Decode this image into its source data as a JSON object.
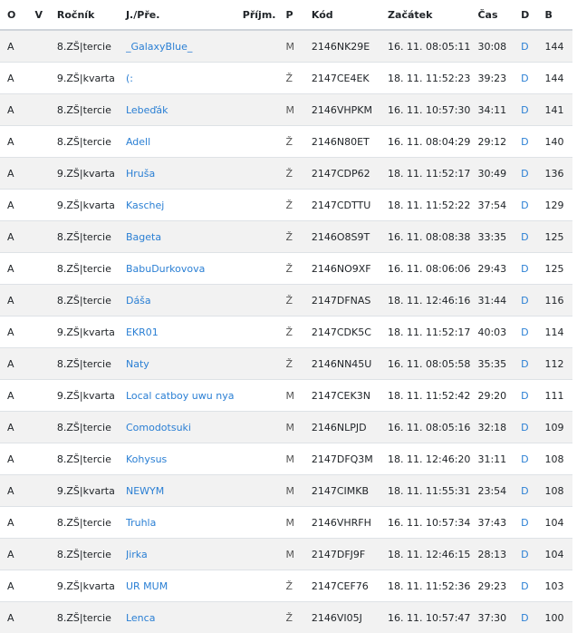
{
  "headers": {
    "o": "O",
    "v": "V",
    "rocnik": "Ročník",
    "name": "J./Pře.",
    "prijm": "Příjm.",
    "p": "P",
    "kod": "Kód",
    "zacatek": "Začátek",
    "cas": "Čas",
    "d": "D",
    "b": "B"
  },
  "rows": [
    {
      "o": "A",
      "v": "",
      "rocnik": "8.ZŠ|tercie",
      "name": "_GalaxyBlue_",
      "prijm": "",
      "p": "M",
      "kod": "2146NK29E",
      "zacatek": "16. 11. 08:05:11",
      "cas": "30:08",
      "d": "D",
      "b": "144"
    },
    {
      "o": "A",
      "v": "",
      "rocnik": "9.ZŠ|kvarta",
      "name": "(:",
      "prijm": "",
      "p": "Ž",
      "kod": "2147CE4EK",
      "zacatek": "18. 11. 11:52:23",
      "cas": "39:23",
      "d": "D",
      "b": "144"
    },
    {
      "o": "A",
      "v": "",
      "rocnik": "8.ZŠ|tercie",
      "name": "Lebeďák",
      "prijm": "",
      "p": "M",
      "kod": "2146VHPKM",
      "zacatek": "16. 11. 10:57:30",
      "cas": "34:11",
      "d": "D",
      "b": "141"
    },
    {
      "o": "A",
      "v": "",
      "rocnik": "8.ZŠ|tercie",
      "name": "Adell",
      "prijm": "",
      "p": "Ž",
      "kod": "2146N80ET",
      "zacatek": "16. 11. 08:04:29",
      "cas": "29:12",
      "d": "D",
      "b": "140"
    },
    {
      "o": "A",
      "v": "",
      "rocnik": "9.ZŠ|kvarta",
      "name": "Hruša",
      "prijm": "",
      "p": "Ž",
      "kod": "2147CDP62",
      "zacatek": "18. 11. 11:52:17",
      "cas": "30:49",
      "d": "D",
      "b": "136"
    },
    {
      "o": "A",
      "v": "",
      "rocnik": "9.ZŠ|kvarta",
      "name": "Kaschej",
      "prijm": "",
      "p": "Ž",
      "kod": "2147CDTTU",
      "zacatek": "18. 11. 11:52:22",
      "cas": "37:54",
      "d": "D",
      "b": "129"
    },
    {
      "o": "A",
      "v": "",
      "rocnik": "8.ZŠ|tercie",
      "name": "Bageta",
      "prijm": "",
      "p": "Ž",
      "kod": "2146O8S9T",
      "zacatek": "16. 11. 08:08:38",
      "cas": "33:35",
      "d": "D",
      "b": "125"
    },
    {
      "o": "A",
      "v": "",
      "rocnik": "8.ZŠ|tercie",
      "name": "BabuDurkovova",
      "prijm": "",
      "p": "Ž",
      "kod": "2146NO9XF",
      "zacatek": "16. 11. 08:06:06",
      "cas": "29:43",
      "d": "D",
      "b": "125"
    },
    {
      "o": "A",
      "v": "",
      "rocnik": "8.ZŠ|tercie",
      "name": "Dáša",
      "prijm": "",
      "p": "Ž",
      "kod": "2147DFNAS",
      "zacatek": "18. 11. 12:46:16",
      "cas": "31:44",
      "d": "D",
      "b": "116"
    },
    {
      "o": "A",
      "v": "",
      "rocnik": "9.ZŠ|kvarta",
      "name": "EKR01",
      "prijm": "",
      "p": "Ž",
      "kod": "2147CDK5C",
      "zacatek": "18. 11. 11:52:17",
      "cas": "40:03",
      "d": "D",
      "b": "114"
    },
    {
      "o": "A",
      "v": "",
      "rocnik": "8.ZŠ|tercie",
      "name": "Naty",
      "prijm": "",
      "p": "Ž",
      "kod": "2146NN45U",
      "zacatek": "16. 11. 08:05:58",
      "cas": "35:35",
      "d": "D",
      "b": "112"
    },
    {
      "o": "A",
      "v": "",
      "rocnik": "9.ZŠ|kvarta",
      "name": "Local catboy uwu nya",
      "prijm": "",
      "p": "M",
      "kod": "2147CEK3N",
      "zacatek": "18. 11. 11:52:42",
      "cas": "29:20",
      "d": "D",
      "b": "111"
    },
    {
      "o": "A",
      "v": "",
      "rocnik": "8.ZŠ|tercie",
      "name": "Comodotsuki",
      "prijm": "",
      "p": "M",
      "kod": "2146NLPJD",
      "zacatek": "16. 11. 08:05:16",
      "cas": "32:18",
      "d": "D",
      "b": "109"
    },
    {
      "o": "A",
      "v": "",
      "rocnik": "8.ZŠ|tercie",
      "name": "Kohysus",
      "prijm": "",
      "p": "M",
      "kod": "2147DFQ3M",
      "zacatek": "18. 11. 12:46:20",
      "cas": "31:11",
      "d": "D",
      "b": "108"
    },
    {
      "o": "A",
      "v": "",
      "rocnik": "9.ZŠ|kvarta",
      "name": "NEWYM",
      "prijm": "",
      "p": "M",
      "kod": "2147CIMKB",
      "zacatek": "18. 11. 11:55:31",
      "cas": "23:54",
      "d": "D",
      "b": "108"
    },
    {
      "o": "A",
      "v": "",
      "rocnik": "8.ZŠ|tercie",
      "name": "Truhla",
      "prijm": "",
      "p": "M",
      "kod": "2146VHRFH",
      "zacatek": "16. 11. 10:57:34",
      "cas": "37:43",
      "d": "D",
      "b": "104"
    },
    {
      "o": "A",
      "v": "",
      "rocnik": "8.ZŠ|tercie",
      "name": "Jirka",
      "prijm": "",
      "p": "M",
      "kod": "2147DFJ9F",
      "zacatek": "18. 11. 12:46:15",
      "cas": "28:13",
      "d": "D",
      "b": "104"
    },
    {
      "o": "A",
      "v": "",
      "rocnik": "9.ZŠ|kvarta",
      "name": "UR MUM",
      "prijm": "",
      "p": "Ž",
      "kod": "2147CEF76",
      "zacatek": "18. 11. 11:52:36",
      "cas": "29:23",
      "d": "D",
      "b": "103"
    },
    {
      "o": "A",
      "v": "",
      "rocnik": "8.ZŠ|tercie",
      "name": "Lenca",
      "prijm": "",
      "p": "Ž",
      "kod": "2146VI05J",
      "zacatek": "16. 11. 10:57:47",
      "cas": "37:30",
      "d": "D",
      "b": "100"
    }
  ]
}
